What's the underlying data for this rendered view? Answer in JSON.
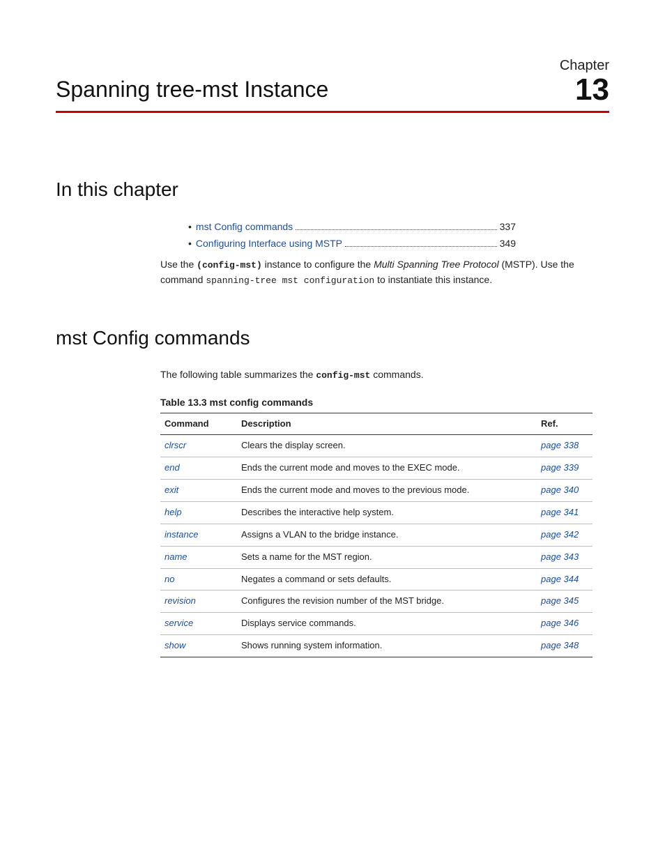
{
  "header": {
    "chapter_label": "Chapter",
    "chapter_number": "13",
    "title": "Spanning tree-mst Instance"
  },
  "section1": {
    "heading": "In this chapter",
    "toc": [
      {
        "label": "mst Config commands",
        "page": "337"
      },
      {
        "label": "Configuring Interface using MSTP",
        "page": "349"
      }
    ],
    "para": {
      "t1": "Use the ",
      "mono1": "(config-mst)",
      "t2": " instance to configure the ",
      "italic": "Multi Spanning Tree Protocol",
      "t3": " (MSTP). Use the command ",
      "mono2": "spanning-tree mst configuration",
      "t4": " to instantiate this instance."
    }
  },
  "section2": {
    "heading": "mst Config commands",
    "intro": {
      "t1": "The following table summarizes the ",
      "mono": "config-mst",
      "t2": " commands."
    },
    "table_caption": "Table 13.3  mst config commands",
    "columns": {
      "c1": "Command",
      "c2": "Description",
      "c3": "Ref."
    },
    "rows": [
      {
        "cmd": "clrscr",
        "desc": "Clears the display screen.",
        "ref": "page 338"
      },
      {
        "cmd": "end",
        "desc": "Ends the current mode and moves to the EXEC mode.",
        "ref": "page 339"
      },
      {
        "cmd": "exit",
        "desc": "Ends the current mode and moves to the previous mode.",
        "ref": "page 340"
      },
      {
        "cmd": "help",
        "desc": "Describes the interactive help system.",
        "ref": "page 341"
      },
      {
        "cmd": "instance",
        "desc": "Assigns a VLAN to the bridge instance.",
        "ref": "page 342"
      },
      {
        "cmd": "name",
        "desc": "Sets a name for the MST region.",
        "ref": "page 343"
      },
      {
        "cmd": "no",
        "desc": "Negates a command or sets defaults.",
        "ref": "page 344"
      },
      {
        "cmd": "revision",
        "desc": "Configures the revision number of the MST bridge.",
        "ref": "page 345"
      },
      {
        "cmd": "service",
        "desc": "Displays service commands.",
        "ref": "page 346"
      },
      {
        "cmd": "show",
        "desc": "Shows running system information.",
        "ref": "page 348"
      }
    ]
  }
}
